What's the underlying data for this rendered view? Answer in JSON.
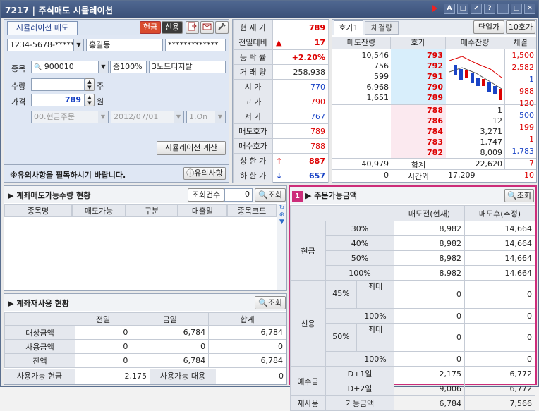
{
  "title": "7217 | 주식매도 시뮬레이션",
  "window_buttons": [
    "A",
    "□",
    "↗",
    "?",
    "_",
    "□",
    "✕"
  ],
  "sim_tab": "시뮬레이션 매도",
  "cash_btn": "현금",
  "credit_btn": "신용",
  "account": "1234-5678-*****",
  "owner": "홍길동",
  "password": "*************",
  "stock_label": "종목",
  "stock_code": "900010",
  "margin": "증100%",
  "stock_name": "3노드디지탈",
  "qty_label": "수량",
  "qty_unit": "주",
  "price_label": "가격",
  "price_value": "789",
  "price_unit": "원",
  "order_type": "00.현금주문",
  "date": "2012/07/01",
  "interval": "1.On",
  "calc_btn": "시뮬레이션 계산",
  "notice": "※유의사항을 필독하시기 바랍니다.",
  "notice_btn": "유의사항",
  "quote": [
    {
      "label": "현 재 가",
      "value": "789",
      "cls": "red",
      "sym": ""
    },
    {
      "label": "전일대비",
      "value": "17",
      "cls": "red",
      "sym": "▲"
    },
    {
      "label": "등 락 률",
      "value": "+2.20%",
      "cls": "red",
      "sym": ""
    },
    {
      "label": "거 래 량",
      "value": "258,938",
      "cls": "",
      "sym": ""
    },
    {
      "label": "시 가",
      "value": "770",
      "cls": "blue",
      "sym": ""
    },
    {
      "label": "고 가",
      "value": "790",
      "cls": "red",
      "sym": ""
    },
    {
      "label": "저 가",
      "value": "767",
      "cls": "blue",
      "sym": ""
    },
    {
      "label": "매도호가",
      "value": "789",
      "cls": "red",
      "sym": ""
    },
    {
      "label": "매수호가",
      "value": "788",
      "cls": "red",
      "sym": ""
    },
    {
      "label": "상 한 가",
      "value": "887",
      "cls": "red",
      "sym": "↑"
    },
    {
      "label": "하 한 가",
      "value": "657",
      "cls": "blue",
      "sym": "↓"
    }
  ],
  "book_tabs": [
    "호가1",
    "체결량"
  ],
  "book_btn1": "단일가",
  "book_btn2": "10호가",
  "book_headers": [
    "매도잔량",
    "호가",
    "매수잔량",
    "체결"
  ],
  "asks": [
    {
      "qty": "10,546",
      "price": "793"
    },
    {
      "qty": "756",
      "price": "792"
    },
    {
      "qty": "599",
      "price": "791"
    },
    {
      "qty": "6,968",
      "price": "790"
    },
    {
      "qty": "1,651",
      "price": "789"
    }
  ],
  "bids": [
    {
      "price": "788",
      "qty": "1"
    },
    {
      "price": "786",
      "qty": "12"
    },
    {
      "price": "784",
      "qty": "3,271"
    },
    {
      "price": "783",
      "qty": "1,747"
    },
    {
      "price": "782",
      "qty": "8,009"
    }
  ],
  "fills": [
    "1,500",
    "2,582",
    "1",
    "988",
    "120",
    "500",
    "199",
    "1",
    "1,783",
    "7",
    "10"
  ],
  "book_total": {
    "ask": "40,979",
    "label": "합계",
    "bid": "22,620"
  },
  "book_after": {
    "ask": "0",
    "label": "시간외",
    "bid": "17,209"
  },
  "sellable": {
    "title": "계좌매도가능수량 현황",
    "count_label": "조회건수",
    "count_value": "0",
    "query_btn": "조회",
    "headers": [
      "종목명",
      "매도가능",
      "구분",
      "대출일",
      "종목코드"
    ]
  },
  "reuse": {
    "title": "계좌재사용 현황",
    "query_btn": "조회",
    "headers": [
      "",
      "전일",
      "금일",
      "합계"
    ],
    "rows": [
      {
        "name": "대상금액",
        "prev": "0",
        "today": "6,784",
        "sum": "6,784"
      },
      {
        "name": "사용금액",
        "prev": "0",
        "today": "0",
        "sum": "0"
      },
      {
        "name": "잔액",
        "prev": "0",
        "today": "6,784",
        "sum": "6,784"
      }
    ],
    "avail_cash_label": "사용가능 현금",
    "avail_cash": "2,175",
    "avail_loan_label": "사용가능 대용",
    "avail_loan": "0"
  },
  "order_avail": {
    "mark": "1",
    "title": "주문가능금액",
    "query_btn": "조회",
    "headers": [
      "매도전(현재)",
      "매도후(추정)"
    ],
    "cash_label": "현금",
    "cash_rows": [
      {
        "pct": "30%",
        "before": "8,982",
        "after": "14,664"
      },
      {
        "pct": "40%",
        "before": "8,982",
        "after": "14,664"
      },
      {
        "pct": "50%",
        "before": "8,982",
        "after": "14,664"
      },
      {
        "pct": "100%",
        "before": "8,982",
        "after": "14,664"
      }
    ],
    "credit_label": "신용",
    "credit_groups": [
      {
        "rate": "45%",
        "rows": [
          {
            "sub": "최대",
            "before": "0",
            "after": "0"
          },
          {
            "sub": "100%",
            "before": "0",
            "after": "0"
          }
        ]
      },
      {
        "rate": "50%",
        "rows": [
          {
            "sub": "최대",
            "before": "0",
            "after": "0"
          },
          {
            "sub": "100%",
            "before": "0",
            "after": "0"
          }
        ]
      }
    ],
    "deposit_label": "예수금",
    "deposit_rows": [
      {
        "sub": "D+1일",
        "before": "2,175",
        "after": "6,772"
      },
      {
        "sub": "D+2일",
        "before": "9,006",
        "after": "6,772"
      }
    ],
    "reuse_label": "재사용",
    "reuse_sub": "가능금액",
    "reuse_before": "6,784",
    "reuse_after": "7,566"
  }
}
